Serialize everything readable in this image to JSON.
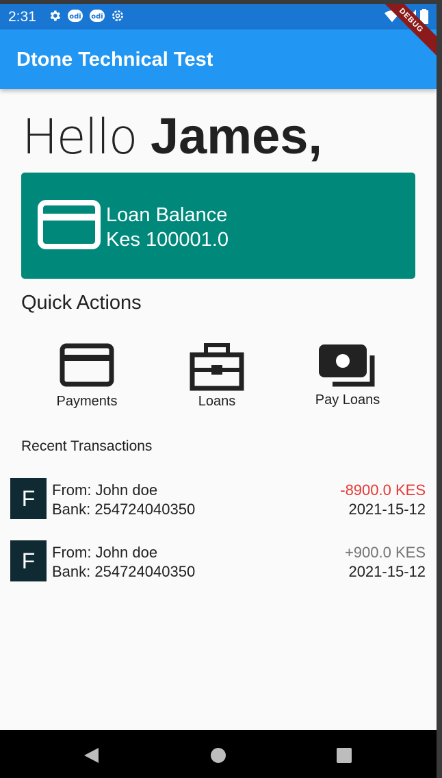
{
  "status_bar": {
    "time": "2:31",
    "icons_left": [
      "gear-icon",
      "odi-icon",
      "odi-icon",
      "settings-icon"
    ],
    "icons_right": [
      "wifi-icon",
      "signal-icon",
      "battery-icon"
    ],
    "color": "#1976d2"
  },
  "debug_banner": "DEBUG",
  "app_bar": {
    "title": "Dtone Technical Test",
    "color": "#2196f3"
  },
  "greeting": {
    "hello": "Hello",
    "name": "James,"
  },
  "loan_card": {
    "icon": "credit-card-icon",
    "label": "Loan Balance",
    "amount": "Kes 100001.0",
    "color": "#00897b"
  },
  "quick_actions": {
    "title": "Quick Actions",
    "items": [
      {
        "label": "Payments",
        "icon": "credit-card-icon"
      },
      {
        "label": "Loans",
        "icon": "briefcase-icon"
      },
      {
        "label": "Pay Loans",
        "icon": "money-icon"
      }
    ]
  },
  "recent_transactions": {
    "title": "Recent Transactions",
    "items": [
      {
        "avatar": "F",
        "from": "From: John doe",
        "bank": "Bank: 254724040350",
        "amount": "-8900.0 KES",
        "date": "2021-15-12",
        "amount_color": "#e53935"
      },
      {
        "avatar": "F",
        "from": "From: John doe",
        "bank": "Bank: 254724040350",
        "amount": "+900.0 KES",
        "date": "2021-15-12",
        "amount_color": "#757575"
      }
    ]
  },
  "nav_bar": {
    "buttons": [
      "back-icon",
      "home-icon",
      "recents-icon"
    ]
  }
}
